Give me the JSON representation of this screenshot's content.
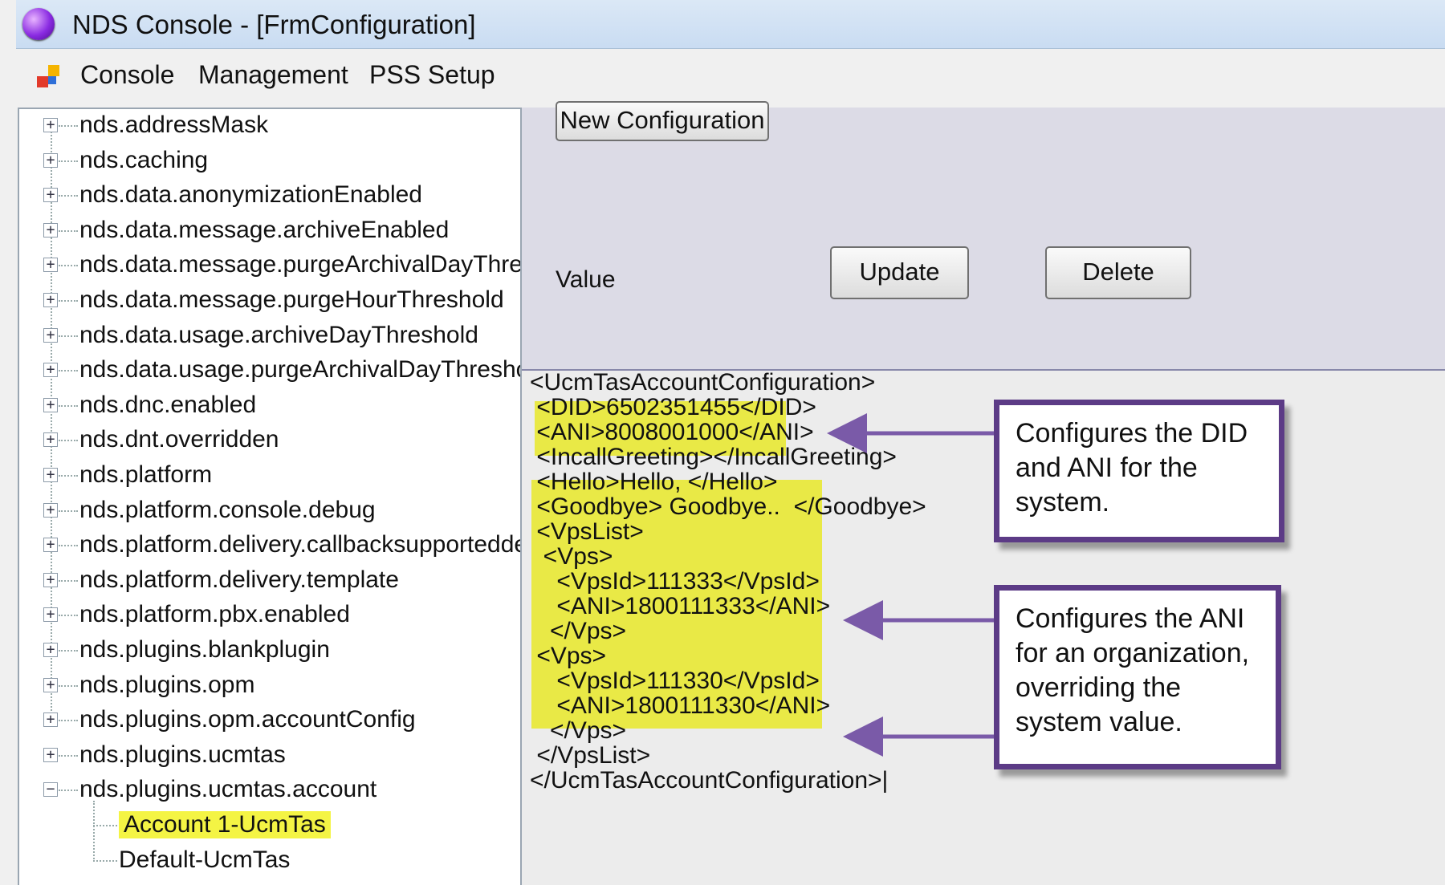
{
  "window": {
    "title": "NDS Console - [FrmConfiguration]"
  },
  "menu": {
    "items": [
      "Console",
      "Management",
      "PSS Setup"
    ]
  },
  "tree": {
    "nodes": [
      "nds.addressMask",
      "nds.caching",
      "nds.data.anonymizationEnabled",
      "nds.data.message.archiveEnabled",
      "nds.data.message.purgeArchivalDayThres",
      "nds.data.message.purgeHourThreshold",
      "nds.data.usage.archiveDayThreshold",
      "nds.data.usage.purgeArchivalDayThreshol",
      "nds.dnc.enabled",
      "nds.dnt.overridden",
      "nds.platform",
      "nds.platform.console.debug",
      "nds.platform.delivery.callbacksupporteddev",
      "nds.platform.delivery.template",
      "nds.platform.pbx.enabled",
      "nds.plugins.blankplugin",
      "nds.plugins.opm",
      "nds.plugins.opm.accountConfig",
      "nds.plugins.ucmtas",
      "nds.plugins.ucmtas.account"
    ],
    "expanded_node": "nds.plugins.ucmtas.account",
    "children": [
      "Account 1-UcmTas",
      "Default-UcmTas"
    ],
    "selected_child": "Account 1-UcmTas"
  },
  "config_panel": {
    "new_button": "New Configuration",
    "value_label": "Value",
    "update_button": "Update",
    "delete_button": "Delete"
  },
  "xml": {
    "lines": [
      "<UcmTasAccountConfiguration>",
      " <DID>6502351455</DID>",
      " <ANI>8008001000</ANI>",
      " <IncallGreeting></IncallGreeting>",
      " <Hello>Hello, </Hello>",
      " <Goodbye> Goodbye..  </Goodbye>",
      " <VpsList>",
      "  <Vps>",
      "    <VpsId>111333</VpsId>",
      "    <ANI>1800111333</ANI>",
      "   </Vps>",
      " <Vps>",
      "    <VpsId>111330</VpsId>",
      "    <ANI>1800111330</ANI>",
      "   </Vps>",
      " </VpsList>",
      "</UcmTasAccountConfiguration>|"
    ]
  },
  "callouts": [
    "Configures the DID and ANI for the system.",
    "Configures the ANI for an organization, overriding the system value."
  ],
  "colors": {
    "highlight": "#e9e946",
    "callout_border": "#5c3b86",
    "arrow": "#7a5aa8"
  }
}
